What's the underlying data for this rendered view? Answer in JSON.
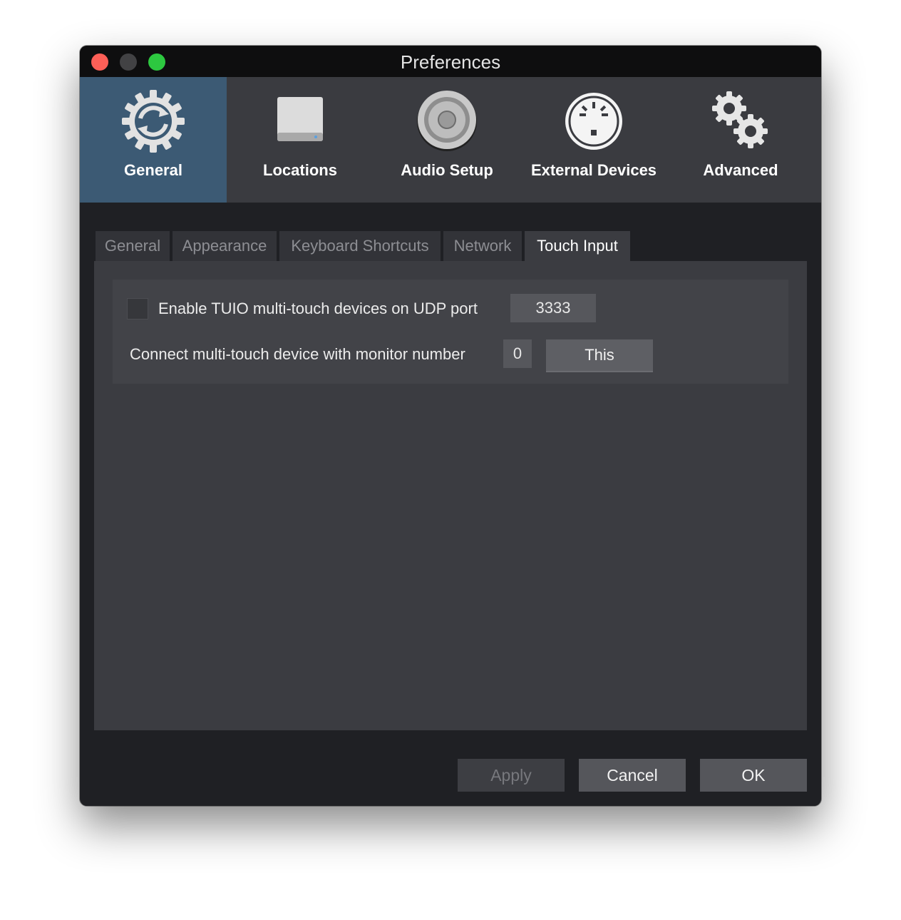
{
  "window": {
    "title": "Preferences"
  },
  "toolbar": {
    "items": [
      {
        "label": "General",
        "icon": "general-sync-gear-icon",
        "active": true
      },
      {
        "label": "Locations",
        "icon": "hard-drive-icon",
        "active": false
      },
      {
        "label": "Audio Setup",
        "icon": "speaker-icon",
        "active": false
      },
      {
        "label": "External Devices",
        "icon": "midi-connector-icon",
        "active": false
      },
      {
        "label": "Advanced",
        "icon": "gears-icon",
        "active": false
      }
    ]
  },
  "tabs": [
    {
      "label": "General",
      "active": false
    },
    {
      "label": "Appearance",
      "active": false
    },
    {
      "label": "Keyboard Shortcuts",
      "active": false
    },
    {
      "label": "Network",
      "active": false
    },
    {
      "label": "Touch Input",
      "active": true
    }
  ],
  "touch_input": {
    "enable_tuio_label": "Enable TUIO multi-touch devices on UDP port",
    "enable_tuio_checked": false,
    "udp_port": "3333",
    "monitor_label": "Connect multi-touch device with monitor number",
    "monitor_number": "0",
    "this_button": "This"
  },
  "footer": {
    "apply": "Apply",
    "cancel": "Cancel",
    "ok": "OK"
  },
  "colors": {
    "active_toolbar": "#3c5a74",
    "toolbar_bg": "#3a3b40",
    "panel_bg": "#3b3c41",
    "close": "#fd5f57",
    "maximize": "#2dc840"
  }
}
